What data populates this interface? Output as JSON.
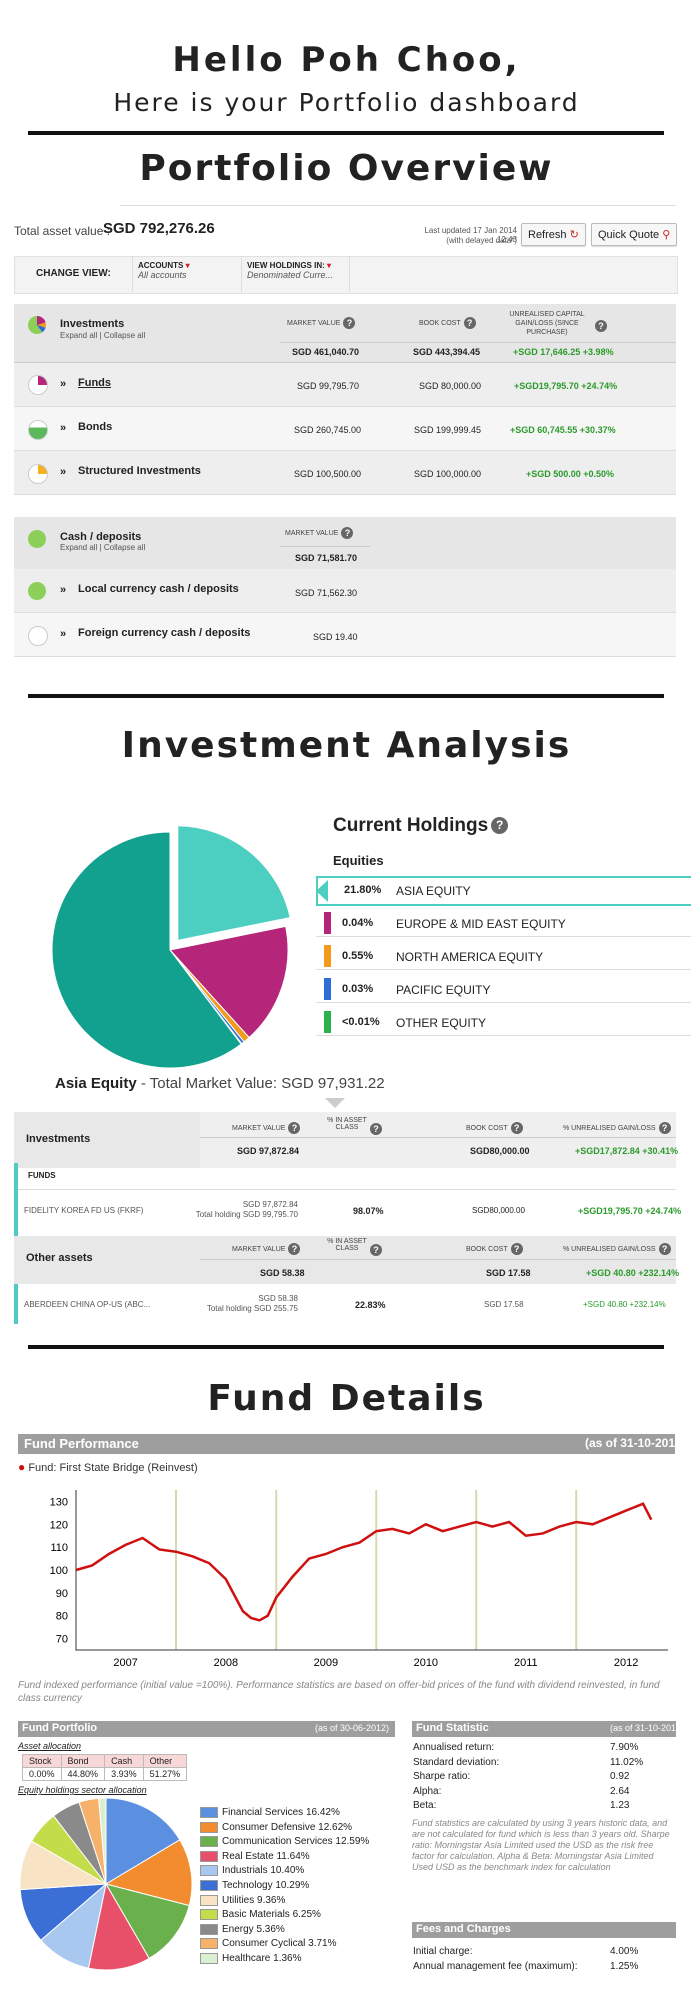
{
  "header": {
    "greeting": "Hello Poh Choo,",
    "subtitle": "Here is your Portfolio dashboard"
  },
  "sections": {
    "overview": "Portfolio Overview",
    "analysis": "Investment Analysis",
    "fund": "Fund Details"
  },
  "overview": {
    "total_label": "Total asset value :",
    "total_value": "SGD 792,276.26",
    "last_updated": "Last updated 17 Jan 2014 12:43",
    "delayed": "(with delayed data*)",
    "refresh": "Refresh",
    "quick_quote": "Quick Quote",
    "change_view": "CHANGE VIEW:",
    "accounts_label": "ACCOUNTS",
    "accounts_value": "All accounts",
    "view_holdings_label": "VIEW HOLDINGS IN:",
    "view_holdings_value": "Denominated Curre...",
    "investments": {
      "title": "Investments",
      "expand": "Expand all",
      "collapse": "Collapse all",
      "col_market": "MARKET VALUE",
      "col_book": "BOOK COST",
      "col_unreal": "UNREALISED CAPITAL GAIN/LOSS (SINCE PURCHASE)",
      "market": "SGD 461,040.70",
      "book": "SGD 443,394.45",
      "gain": "+SGD 17,646.25 +3.98%"
    },
    "rows": [
      {
        "label": "Funds",
        "market": "SGD 99,795.70",
        "book": "SGD 80,000.00",
        "gain": "+SGD19,795.70 +24.74%"
      },
      {
        "label": "Bonds",
        "market": "SGD 260,745.00",
        "book": "SGD 199,999.45",
        "gain": "+SGD 60,745.55 +30.37%"
      },
      {
        "label": "Structured Investments",
        "market": "SGD 100,500.00",
        "book": "SGD 100,000.00",
        "gain": "+SGD 500.00 +0.50%"
      }
    ],
    "cash": {
      "title": "Cash / deposits",
      "expand": "Expand all",
      "collapse": "Collapse all",
      "col_market": "MARKET VALUE",
      "market": "SGD 71,581.70",
      "rows": [
        {
          "label": "Local currency cash / deposits",
          "market": "SGD 71,562.30"
        },
        {
          "label": "Foreign currency cash / deposits",
          "market": "SGD 19.40"
        }
      ]
    }
  },
  "analysis": {
    "holdings_title": "Current Holdings",
    "equities": "Equities",
    "holdings": [
      {
        "pct": "21.80%",
        "name": "ASIA EQUITY",
        "color": "#4ccfc0"
      },
      {
        "pct": "0.04%",
        "name": "EUROPE & MID EAST EQUITY",
        "color": "#b5267a"
      },
      {
        "pct": "0.55%",
        "name": "NORTH AMERICA EQUITY",
        "color": "#f39a1e"
      },
      {
        "pct": "0.03%",
        "name": "PACIFIC EQUITY",
        "color": "#2d6fd6"
      },
      {
        "pct": "<0.01%",
        "name": "OTHER EQUITY",
        "color": "#2bb24c"
      }
    ],
    "asia_label": "Asia Equity",
    "asia_total": "- Total Market Value: SGD 97,931.22",
    "table": {
      "investments": "Investments",
      "col_market": "MARKET VALUE",
      "col_pct": "% IN ASSET CLASS",
      "col_book": "BOOK COST",
      "col_unreal": "% UNREALISED GAIN/LOSS",
      "inv_market": "SGD 97,872.84",
      "inv_book": "SGD80,000.00",
      "inv_gain": "+SGD17,872.84 +30.41%",
      "funds": "FUNDS",
      "fund_name": "FIDELITY KOREA FD US (FKRF)",
      "fund_market": "SGD 97,872.84",
      "fund_total": "Total holding SGD 99,795.70",
      "fund_pct": "98.07%",
      "fund_book": "SGD80,000.00",
      "fund_gain": "+SGD19,795.70 +24.74%",
      "other": "Other assets",
      "other_market": "SGD 58.38",
      "other_book": "SGD 17.58",
      "other_gain": "+SGD 40.80 +232.14%",
      "ab_name": "ABERDEEN CHINA OP-US (ABC...",
      "ab_market": "SGD 58.38",
      "ab_total": "Total holding SGD 255.75",
      "ab_pct": "22.83%",
      "ab_book": "SGD 17.58",
      "ab_gain": "+SGD 40.80 +232.14%"
    }
  },
  "fund": {
    "perf_title": "Fund Performance",
    "perf_asof": "(as of 31-10-201",
    "legend": "Fund: First State Bridge (Reinvest)",
    "note": "Fund indexed performance (initial value =100%). Performance statistics are based on offer-bid prices of the fund with dividend reinvested, in fund class currency",
    "portfolio_title": "Fund Portfolio",
    "portfolio_asof": "(as of 30-06-2012)",
    "asset_alloc": "Asset allocation",
    "alloc_headers": [
      "Stock",
      "Bond",
      "Cash",
      "Other"
    ],
    "alloc_values": [
      "0.00%",
      "44.80%",
      "3.93%",
      "51.27%"
    ],
    "sector_label": "Equity holdings sector allocation",
    "sectors": [
      {
        "name": "Financial Services",
        "pct": "16.42%",
        "color": "#5b8fe0"
      },
      {
        "name": "Consumer Defensive",
        "pct": "12.62%",
        "color": "#f28c2e"
      },
      {
        "name": "Communication Services",
        "pct": "12.59%",
        "color": "#6ab04c"
      },
      {
        "name": "Real Estate",
        "pct": "11.64%",
        "color": "#e8506a"
      },
      {
        "name": "Industrials",
        "pct": "10.40%",
        "color": "#a9c8f0"
      },
      {
        "name": "Technology",
        "pct": "10.29%",
        "color": "#3b6fd6"
      },
      {
        "name": "Utilities",
        "pct": "9.36%",
        "color": "#f8e3c4"
      },
      {
        "name": "Basic Materials",
        "pct": "6.25%",
        "color": "#c3dd4a"
      },
      {
        "name": "Energy",
        "pct": "5.36%",
        "color": "#8a8a8a"
      },
      {
        "name": "Consumer Cyclical",
        "pct": "3.71%",
        "color": "#f6b26b"
      },
      {
        "name": "Healthcare",
        "pct": "1.36%",
        "color": "#d9efd0"
      }
    ],
    "stat_title": "Fund Statistic",
    "stat_asof": "(as of 31-10-201",
    "stats": [
      {
        "label": "Annualised return:",
        "value": "7.90%"
      },
      {
        "label": "Standard deviation:",
        "value": "11.02%"
      },
      {
        "label": "Sharpe ratio:",
        "value": "0.92"
      },
      {
        "label": "Alpha:",
        "value": "2.64"
      },
      {
        "label": "Beta:",
        "value": "1.23"
      }
    ],
    "stat_note": "Fund statistics are calculated by using 3 years historic data, and are not calculated for fund which is less than 3 years old. Sharpe ratio: Morningstar Asia Limited used the USD as the risk free factor for calculation. Alpha & Beta: Morningstar Asia Limited Used USD as the benchmark index for calculation",
    "fees_title": "Fees and Charges",
    "fees": [
      {
        "label": "Initial charge:",
        "value": "4.00%"
      },
      {
        "label": "Annual management fee (maximum):",
        "value": "1.25%"
      }
    ]
  },
  "chart_data": [
    {
      "type": "pie",
      "labels": [
        "ASIA EQUITY",
        "EUROPE & MID EAST EQUITY",
        "NORTH AMERICA EQUITY",
        "PACIFIC EQUITY",
        "OTHER EQUITY",
        "Other"
      ],
      "values": [
        21.8,
        16.5,
        0.9,
        0.4,
        0.1,
        60.3
      ],
      "colors": [
        "#4ccfc0",
        "#b5267a",
        "#f39a1e",
        "#2d6fd6",
        "#2bb24c",
        "#12a08f"
      ]
    },
    {
      "type": "line",
      "x": [
        "2007-01",
        "2007-03",
        "2007-05",
        "2007-07",
        "2007-09",
        "2007-11",
        "2008-01",
        "2008-03",
        "2008-05",
        "2008-07",
        "2008-09",
        "2008-10",
        "2008-11",
        "2008-12",
        "2009-01",
        "2009-03",
        "2009-05",
        "2009-07",
        "2009-09",
        "2009-11",
        "2010-01",
        "2010-03",
        "2010-05",
        "2010-07",
        "2010-09",
        "2010-11",
        "2011-01",
        "2011-03",
        "2011-05",
        "2011-07",
        "2011-09",
        "2011-11",
        "2012-01",
        "2012-03",
        "2012-05",
        "2012-07",
        "2012-09",
        "2012-10"
      ],
      "values": [
        100,
        102,
        107,
        111,
        114,
        109,
        108,
        106,
        103,
        96,
        82,
        79,
        78,
        80,
        88,
        97,
        105,
        107,
        110,
        112,
        117,
        118,
        116,
        120,
        117,
        119,
        121,
        119,
        121,
        115,
        116,
        119,
        121,
        120,
        123,
        126,
        129,
        122
      ],
      "xticks": [
        "2007",
        "2008",
        "2009",
        "2010",
        "2011",
        "2012"
      ],
      "yticks": [
        70,
        80,
        90,
        100,
        110,
        120,
        130
      ],
      "ylim": [
        65,
        135
      ]
    },
    {
      "type": "pie",
      "labels": [
        "Financial Services",
        "Consumer Defensive",
        "Communication Services",
        "Real Estate",
        "Industrials",
        "Technology",
        "Utilities",
        "Basic Materials",
        "Energy",
        "Consumer Cyclical",
        "Healthcare"
      ],
      "values": [
        16.42,
        12.62,
        12.59,
        11.64,
        10.4,
        10.29,
        9.36,
        6.25,
        5.36,
        3.71,
        1.36
      ]
    }
  ]
}
